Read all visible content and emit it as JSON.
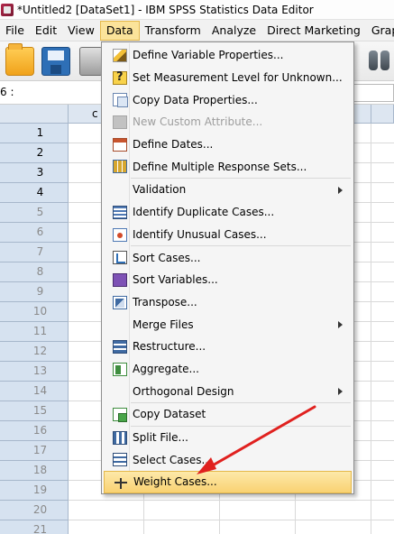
{
  "window": {
    "title": "*Untitled2 [DataSet1] - IBM SPSS Statistics Data Editor"
  },
  "menubar": {
    "items": [
      "File",
      "Edit",
      "View",
      "Data",
      "Transform",
      "Analyze",
      "Direct Marketing",
      "Graphs"
    ],
    "active": "Data"
  },
  "refbar": {
    "cell_ref": "6 :"
  },
  "grid": {
    "column_header": "c",
    "row_numbers": [
      "1",
      "2",
      "3",
      "4",
      "5",
      "6",
      "7",
      "8",
      "9",
      "10",
      "11",
      "12",
      "13",
      "14",
      "15",
      "16",
      "17",
      "18",
      "19",
      "20",
      "21"
    ]
  },
  "data_menu": {
    "items": [
      {
        "label": "Define Variable Properties...",
        "icon": "pencil-icon"
      },
      {
        "label": "Set Measurement Level for Unknown...",
        "icon": "question-icon"
      },
      {
        "label": "Copy Data Properties...",
        "icon": "copy-properties-icon"
      },
      {
        "label": "New Custom Attribute...",
        "icon": "custom-attribute-icon",
        "disabled": true
      },
      {
        "label": "Define Dates...",
        "icon": "calendar-icon"
      },
      {
        "label": "Define Multiple Response Sets...",
        "icon": "grid-icon"
      },
      {
        "label": "Validation",
        "submenu": true
      },
      {
        "label": "Identify Duplicate Cases...",
        "icon": "duplicate-cases-icon"
      },
      {
        "label": "Identify Unusual Cases...",
        "icon": "unusual-cases-icon"
      },
      {
        "label": "Sort Cases...",
        "icon": "sort-cases-icon"
      },
      {
        "label": "Sort Variables...",
        "icon": "sort-variables-icon"
      },
      {
        "label": "Transpose...",
        "icon": "transpose-icon"
      },
      {
        "label": "Merge Files",
        "submenu": true
      },
      {
        "label": "Restructure...",
        "icon": "restructure-icon"
      },
      {
        "label": "Aggregate...",
        "icon": "aggregate-icon"
      },
      {
        "label": "Orthogonal Design",
        "submenu": true
      },
      {
        "label": "Copy Dataset",
        "icon": "copy-dataset-icon"
      },
      {
        "label": "Split File...",
        "icon": "split-file-icon"
      },
      {
        "label": "Select Cases...",
        "icon": "select-cases-icon"
      },
      {
        "label": "Weight Cases...",
        "icon": "scale-icon",
        "highlighted": true
      }
    ]
  },
  "colors": {
    "menu_highlight": "#f9d272",
    "annotation_arrow": "#e0211f"
  }
}
